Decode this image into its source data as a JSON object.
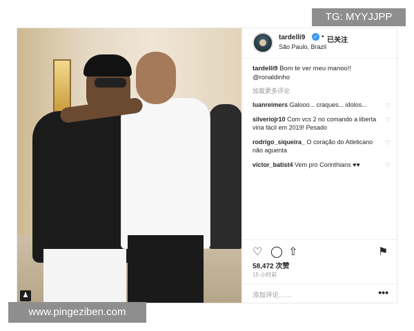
{
  "watermarks": {
    "top": "TG: MYYJJPP",
    "bottom": "www.pingeziben.com"
  },
  "post": {
    "user": {
      "username": "tardelli9",
      "follow_label": "已关注",
      "dot": "•",
      "location": "São Paulo, Brazil"
    },
    "caption": {
      "username": "tardelli9",
      "text": "Bom te ver meu manoo!!",
      "mention": "@ronaldinho"
    },
    "view_all_comments": "加载更多评论",
    "comments": [
      {
        "user": "luanreimers",
        "text": "Galooo... craques... idolos..."
      },
      {
        "user": "silveriojr10",
        "text": "Com vcs 2 no comando a liberta viria fácil em 2019! Pesado"
      },
      {
        "user": "rodrigo_siqueira_",
        "text": "O coração do Atleticano não aguenta"
      },
      {
        "user": "victor_batist4",
        "text": "Vem pro Corinthians ♥♥"
      }
    ],
    "likes": "58,472 次赞",
    "time": "15 小时前",
    "comment_placeholder": "添加评论……",
    "more": "•••"
  },
  "icons": {
    "heart": "heart-icon",
    "comment": "comment-icon",
    "share": "share-icon",
    "bookmark": "bookmark-icon",
    "verified": "verified-badge-icon",
    "tag": "user-tag-icon"
  },
  "colors": {
    "verified": "#3897f0",
    "muted": "#999999",
    "text": "#262626"
  }
}
